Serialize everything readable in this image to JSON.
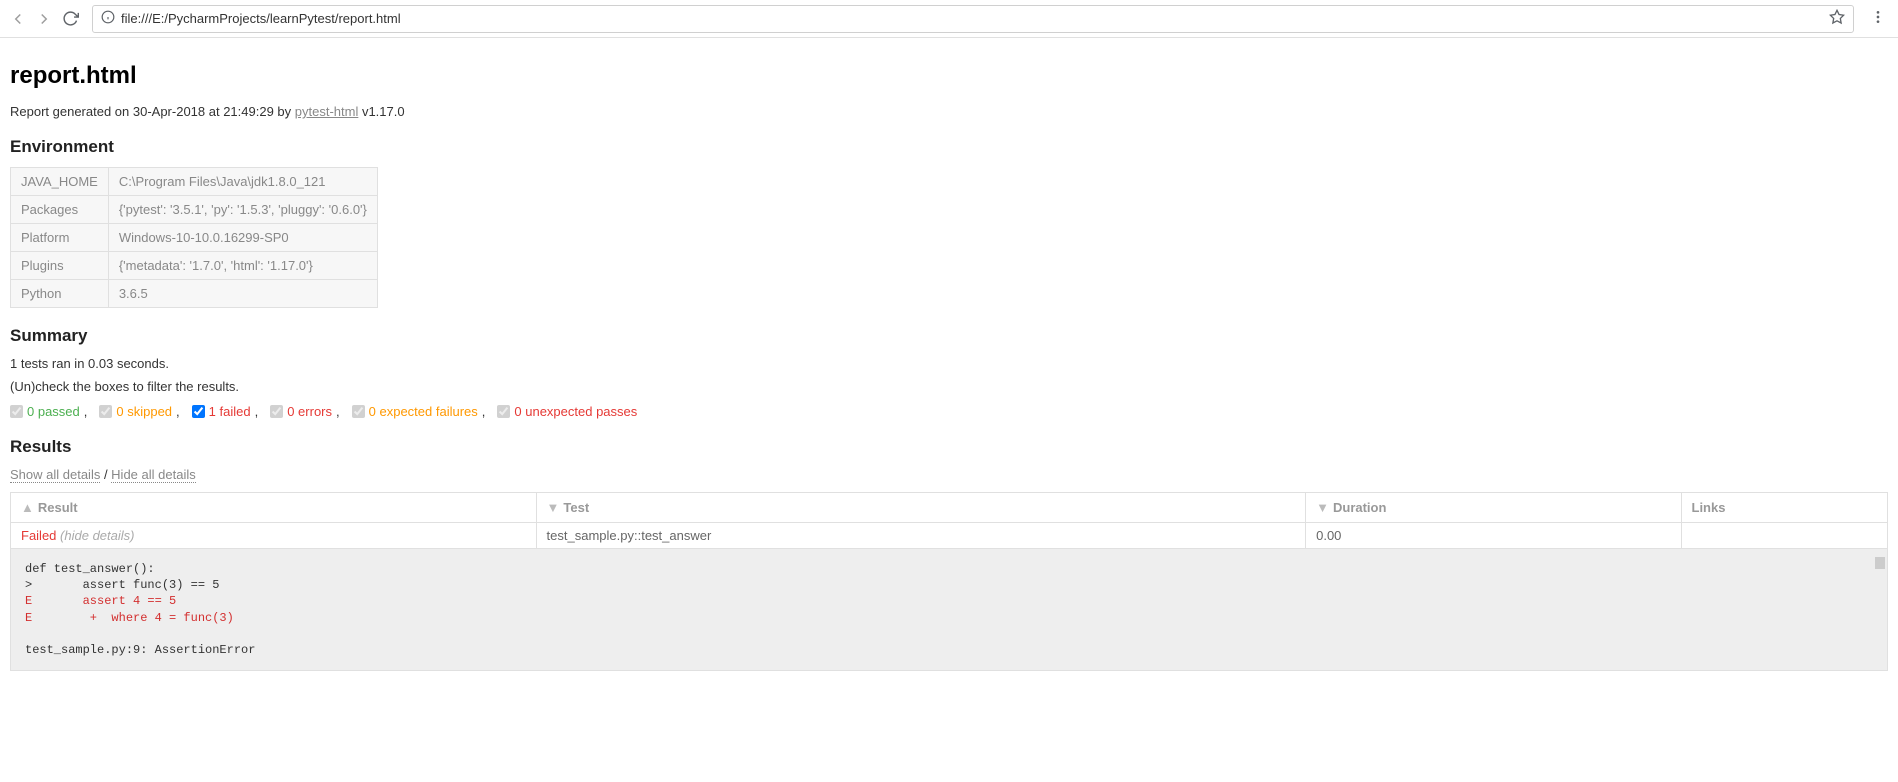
{
  "browser": {
    "url": "file:///E:/PycharmProjects/learnPytest/report.html"
  },
  "report": {
    "title": "report.html",
    "generated_prefix": "Report generated on 30-Apr-2018 at 21:49:29 by ",
    "plugin_link_text": "pytest-html",
    "plugin_version": " v1.17.0"
  },
  "headings": {
    "environment": "Environment",
    "summary": "Summary",
    "results": "Results"
  },
  "environment": {
    "rows": [
      {
        "key": "JAVA_HOME",
        "value": "C:\\Program Files\\Java\\jdk1.8.0_121"
      },
      {
        "key": "Packages",
        "value": "{'pytest': '3.5.1', 'py': '1.5.3', 'pluggy': '0.6.0'}"
      },
      {
        "key": "Platform",
        "value": "Windows-10-10.0.16299-SP0"
      },
      {
        "key": "Plugins",
        "value": "{'metadata': '1.7.0', 'html': '1.17.0'}"
      },
      {
        "key": "Python",
        "value": "3.6.5"
      }
    ]
  },
  "summary": {
    "tests_ran": "1 tests ran in 0.03 seconds.",
    "filter_hint": "(Un)check the boxes to filter the results."
  },
  "filters": {
    "passed": "0 passed",
    "skipped": "0 skipped",
    "failed": "1 failed",
    "errors": "0 errors",
    "xfailed": "0 expected failures",
    "xpassed": "0 unexpected passes"
  },
  "details_links": {
    "show_all": "Show all details",
    "separator": " / ",
    "hide_all": "Hide all details"
  },
  "resultsTable": {
    "headers": {
      "result": "Result",
      "test": "Test",
      "duration": "Duration",
      "links": "Links"
    },
    "row": {
      "result": "Failed",
      "hide_details": "(hide details)",
      "test": "test_sample.py::test_answer",
      "duration": "0.00",
      "links": ""
    }
  },
  "log": {
    "line1": "def test_answer():",
    "line2": ">       assert func(3) == 5",
    "line3": "E       assert 4 == 5",
    "line4": "E        +  where 4 = func(3)",
    "blank": "",
    "line5": "test_sample.py:9: AssertionError"
  }
}
